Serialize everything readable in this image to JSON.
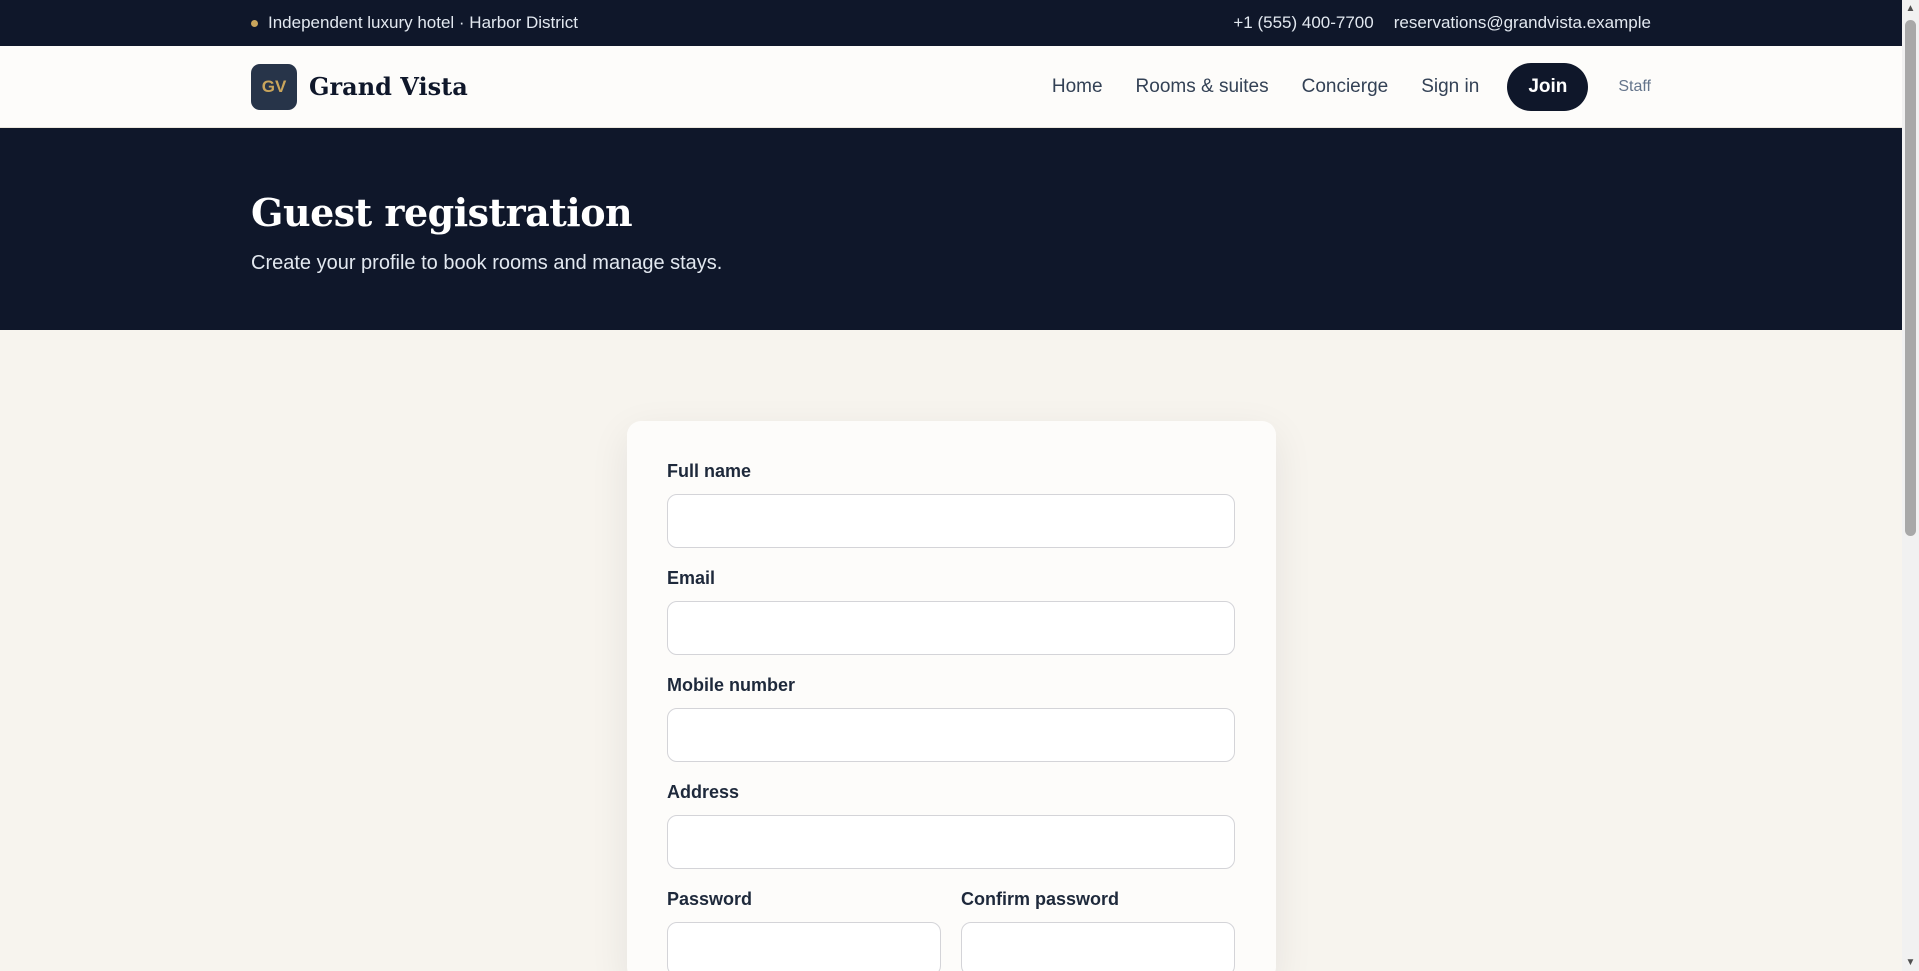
{
  "topbar": {
    "tagline": "Independent luxury hotel · Harbor District",
    "phone": "+1 (555) 400-7700",
    "email": "reservations@grandvista.example"
  },
  "brand": {
    "logo_initials": "GV",
    "name": "Grand Vista"
  },
  "nav": {
    "items": [
      {
        "label": "Home"
      },
      {
        "label": "Rooms & suites"
      },
      {
        "label": "Concierge"
      },
      {
        "label": "Sign in"
      }
    ],
    "join_label": "Join",
    "staff_label": "Staff"
  },
  "hero": {
    "title": "Guest registration",
    "subtitle": "Create your profile to book rooms and manage stays."
  },
  "form": {
    "full_name": {
      "label": "Full name",
      "value": ""
    },
    "email": {
      "label": "Email",
      "value": ""
    },
    "mobile": {
      "label": "Mobile number",
      "value": ""
    },
    "address": {
      "label": "Address",
      "value": ""
    },
    "password": {
      "label": "Password",
      "value": ""
    },
    "confirm_password": {
      "label": "Confirm password",
      "value": ""
    }
  },
  "colors": {
    "navy": "#0f172a",
    "gold": "#c9a55c",
    "cream": "#f7f4ee"
  }
}
